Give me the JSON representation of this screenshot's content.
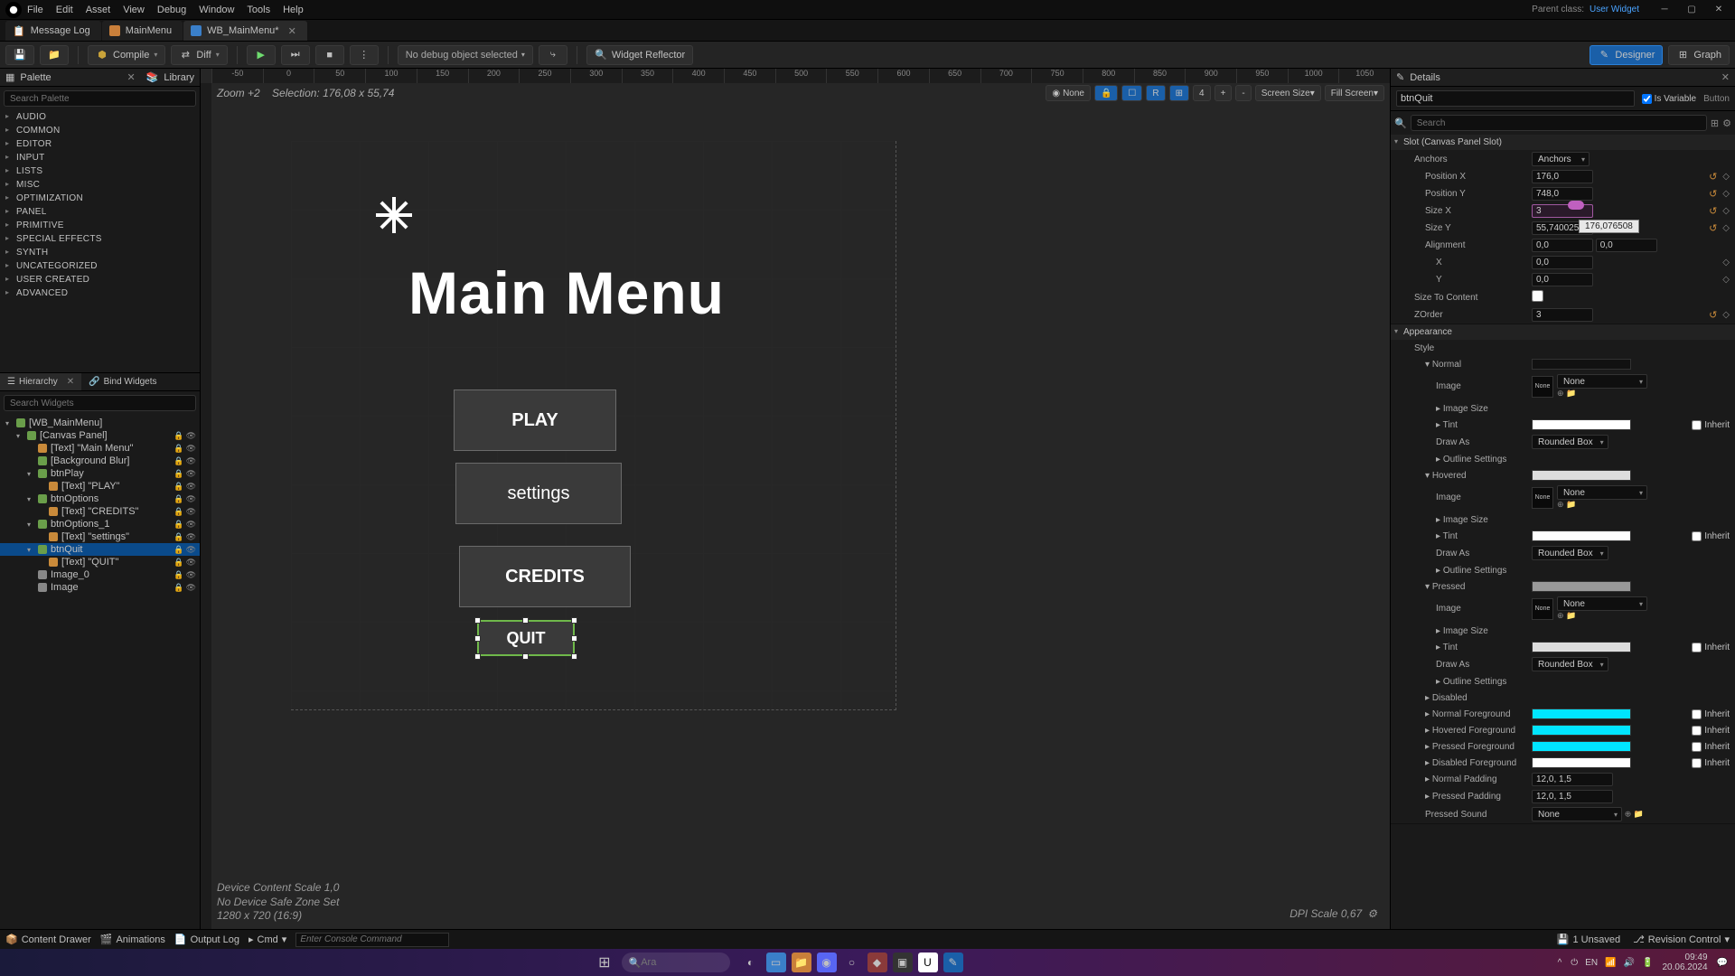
{
  "menubar": [
    "File",
    "Edit",
    "Asset",
    "View",
    "Debug",
    "Window",
    "Tools",
    "Help"
  ],
  "titlebar_right": {
    "parent_label": "Parent class:",
    "parent_link": "User Widget"
  },
  "tabs": [
    {
      "icon": "msg",
      "label": "Message Log",
      "active": false
    },
    {
      "icon": "level",
      "label": "MainMenu",
      "active": false
    },
    {
      "icon": "widget",
      "label": "WB_MainMenu*",
      "active": true
    }
  ],
  "toolbar": {
    "compile": "Compile",
    "diff": "Diff",
    "debug_select": "No debug object selected",
    "widget_reflector": "Widget Reflector",
    "designer": "Designer",
    "graph": "Graph"
  },
  "palette": {
    "title": "Palette",
    "library_tab": "Library",
    "search_ph": "Search Palette",
    "categories": [
      "AUDIO",
      "COMMON",
      "EDITOR",
      "INPUT",
      "LISTS",
      "MISC",
      "OPTIMIZATION",
      "PANEL",
      "PRIMITIVE",
      "SPECIAL EFFECTS",
      "SYNTH",
      "UNCATEGORIZED",
      "USER CREATED",
      "ADVANCED"
    ]
  },
  "hierarchy": {
    "title": "Hierarchy",
    "bind_tab": "Bind Widgets",
    "search_ph": "Search Widgets",
    "tree": [
      {
        "d": 0,
        "label": "[WB_MainMenu]",
        "caret": "▾",
        "t": "root"
      },
      {
        "d": 1,
        "label": "[Canvas Panel]",
        "caret": "▾",
        "t": "panel",
        "eyes": true
      },
      {
        "d": 2,
        "label": "[Text] \"Main Menu\"",
        "t": "txt",
        "eyes": true
      },
      {
        "d": 2,
        "label": "[Background Blur]",
        "t": "panel",
        "eyes": true
      },
      {
        "d": 2,
        "label": "btnPlay",
        "caret": "▾",
        "t": "btn",
        "eyes": true
      },
      {
        "d": 3,
        "label": "[Text] \"PLAY\"",
        "t": "txt",
        "eyes": true
      },
      {
        "d": 2,
        "label": "btnOptions",
        "caret": "▾",
        "t": "btn",
        "eyes": true
      },
      {
        "d": 3,
        "label": "[Text] \"CREDITS\"",
        "t": "txt",
        "eyes": true
      },
      {
        "d": 2,
        "label": "btnOptions_1",
        "caret": "▾",
        "t": "btn",
        "eyes": true
      },
      {
        "d": 3,
        "label": "[Text] \"settings\"",
        "t": "txt",
        "eyes": true
      },
      {
        "d": 2,
        "label": "btnQuit",
        "caret": "▾",
        "t": "btn",
        "eyes": true,
        "sel": true
      },
      {
        "d": 3,
        "label": "[Text] \"QUIT\"",
        "t": "txt",
        "eyes": true
      },
      {
        "d": 2,
        "label": "Image_0",
        "t": "img",
        "eyes": true
      },
      {
        "d": 2,
        "label": "Image",
        "t": "img",
        "eyes": true
      }
    ]
  },
  "canvas": {
    "zoom": "Zoom +2",
    "selection": "Selection: 176,08 x 55,74",
    "none": "None",
    "screen_size": "Screen Size",
    "fill_screen": "Fill Screen",
    "title_text": "Main Menu",
    "btn_play": "PLAY",
    "btn_settings": "settings",
    "btn_credits": "CREDITS",
    "btn_quit": "QUIT",
    "bottom0": "Device Content Scale 1,0",
    "bottom1": "No Device Safe Zone Set",
    "bottom2": "1280 x 720 (16:9)",
    "dpi": "DPI Scale 0,67",
    "ruler_h": [
      "-50",
      "0",
      "50",
      "100",
      "150",
      "200",
      "250",
      "300",
      "350",
      "400",
      "450",
      "500",
      "550",
      "600",
      "650",
      "700",
      "750",
      "800",
      "850",
      "900",
      "950",
      "1000",
      "1050"
    ]
  },
  "details": {
    "title": "Details",
    "search_ph": "Search",
    "name": "btnQuit",
    "is_variable": "Is Variable",
    "type": "Button",
    "slot_hdr": "Slot (Canvas Panel Slot)",
    "anchors": {
      "lbl": "Anchors",
      "val": "Anchors"
    },
    "pos_x": {
      "lbl": "Position X",
      "val": "176,0"
    },
    "pos_y": {
      "lbl": "Position Y",
      "val": "748,0"
    },
    "size_x": {
      "lbl": "Size X",
      "val": "3"
    },
    "size_y": {
      "lbl": "Size Y",
      "val": "55,740025",
      "tooltip": "176,076508"
    },
    "alignment": {
      "lbl": "Alignment",
      "x": "0,0",
      "y": "0,0"
    },
    "x_in": {
      "lbl": "X",
      "val": "0,0"
    },
    "y_in": {
      "lbl": "Y",
      "val": "0,0"
    },
    "size_to_content": {
      "lbl": "Size To Content"
    },
    "zorder": {
      "lbl": "ZOrder",
      "val": "3"
    },
    "appearance_hdr": "Appearance",
    "style_hdr": "Style",
    "normal_hdr": "Normal",
    "hovered_hdr": "Hovered",
    "pressed_hdr": "Pressed",
    "disabled_hdr": "Disabled",
    "image_lbl": "Image",
    "image_val": "None",
    "thumb": "None",
    "image_size_lbl": "Image Size",
    "tint_lbl": "Tint",
    "inherit_lbl": "Inherit",
    "draw_as_lbl": "Draw As",
    "draw_as_val": "Rounded Box",
    "outline_lbl": "Outline Settings",
    "normal_fg": "Normal Foreground",
    "hovered_fg": "Hovered Foreground",
    "pressed_fg": "Pressed Foreground",
    "disabled_fg": "Disabled Foreground",
    "normal_pad": {
      "lbl": "Normal Padding",
      "val": "12,0, 1,5"
    },
    "pressed_pad": {
      "lbl": "Pressed Padding",
      "val": "12,0, 1,5"
    },
    "pressed_sound": {
      "lbl": "Pressed Sound",
      "val": "None"
    }
  },
  "cmdbar": {
    "content_drawer": "Content Drawer",
    "animations": "Animations",
    "output_log": "Output Log",
    "cmd": "Cmd",
    "cmd_ph": "Enter Console Command",
    "unsaved": "1 Unsaved",
    "revision": "Revision Control"
  },
  "taskbar": {
    "search_ph": "Ara",
    "time": "09:49",
    "date": "20.06.2024"
  }
}
